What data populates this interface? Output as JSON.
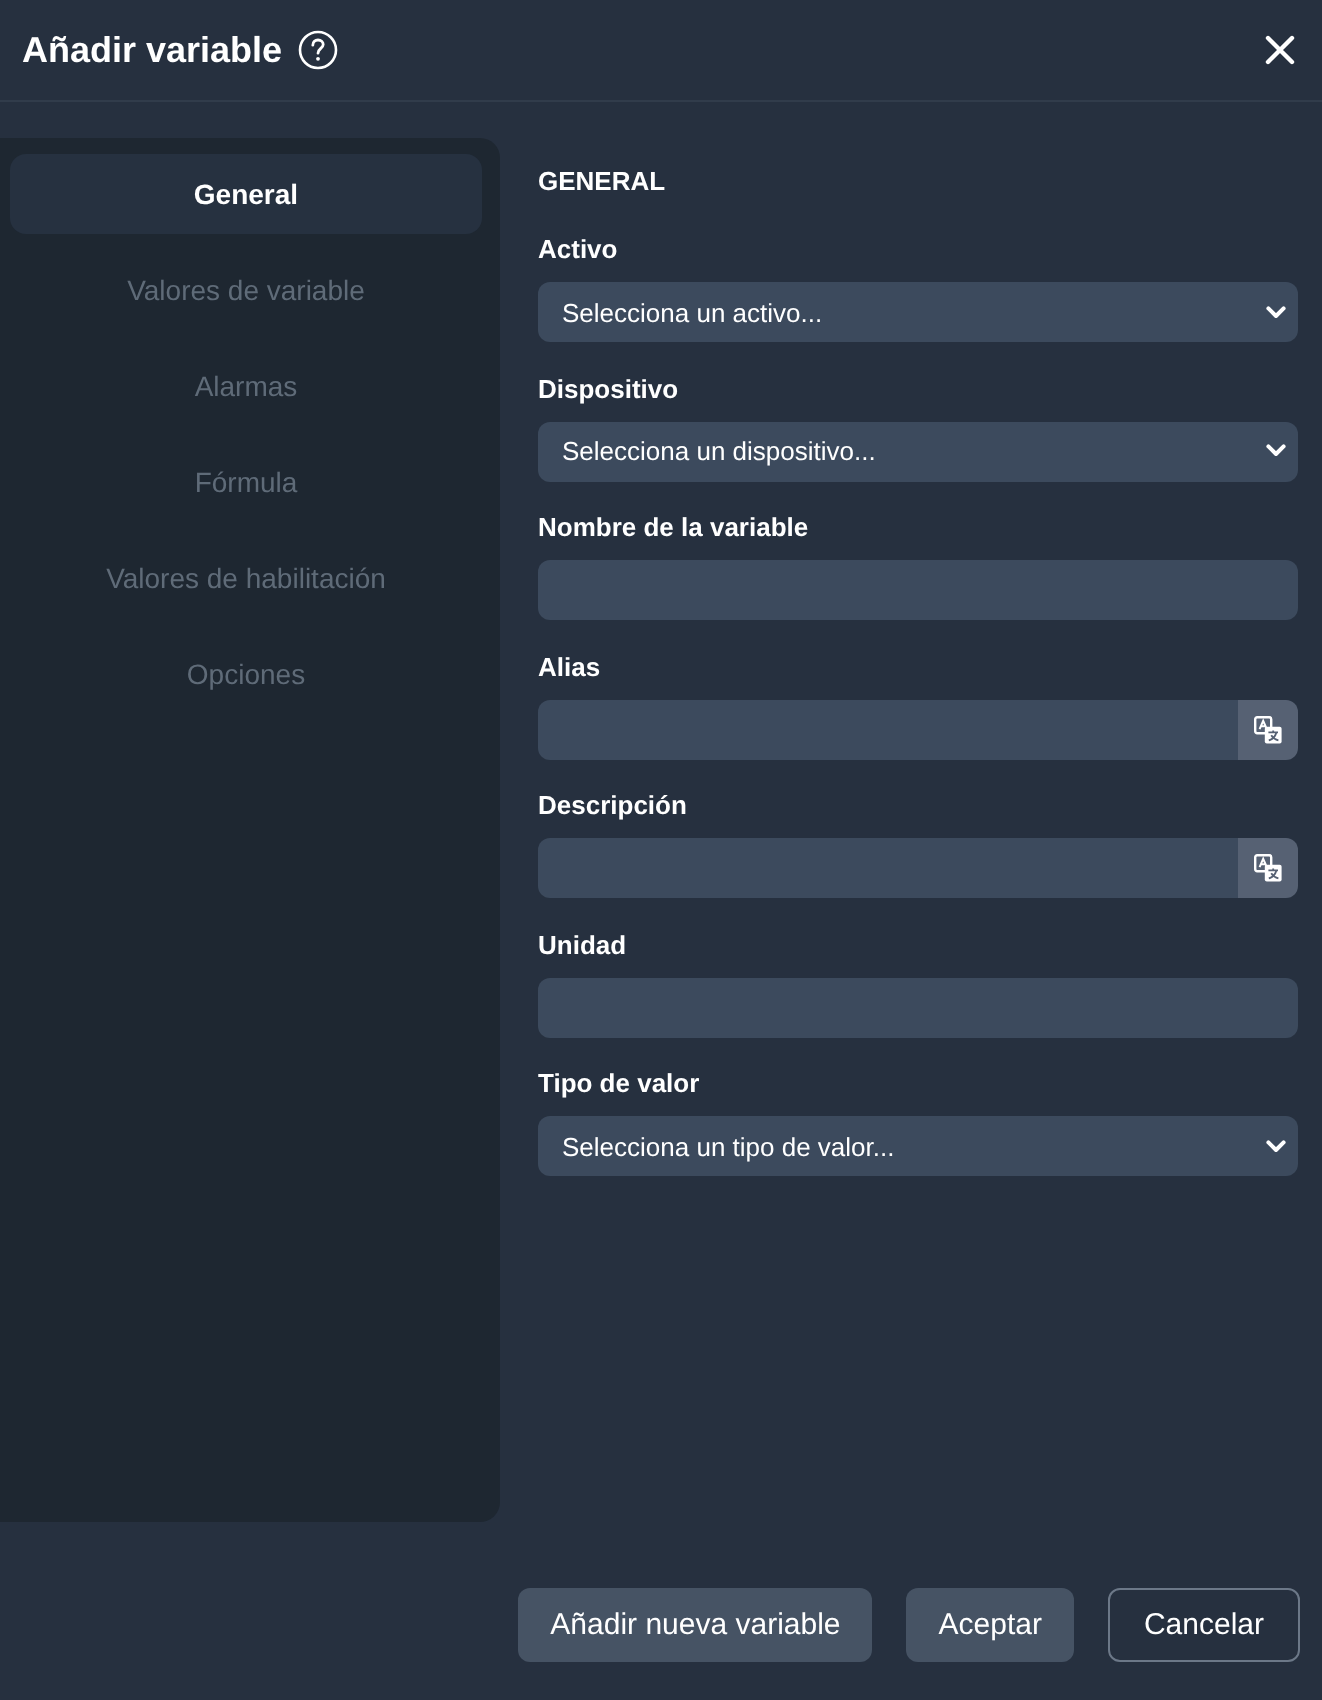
{
  "window": {
    "title": "Añadir variable"
  },
  "sidebar": {
    "items": [
      {
        "label": "General",
        "selected": true
      },
      {
        "label": "Valores de variable",
        "selected": false
      },
      {
        "label": "Alarmas",
        "selected": false
      },
      {
        "label": "Fórmula",
        "selected": false
      },
      {
        "label": "Valores de habilitación",
        "selected": false
      },
      {
        "label": "Opciones",
        "selected": false
      }
    ]
  },
  "form": {
    "section_title": "GENERAL",
    "fields": [
      {
        "kind": "select",
        "label": "Activo",
        "value": "Selecciona un activo..."
      },
      {
        "kind": "select",
        "label": "Dispositivo",
        "value": "Selecciona un dispositivo..."
      },
      {
        "kind": "text",
        "label": "Nombre de la variable"
      },
      {
        "kind": "translatable",
        "label": "Alias"
      },
      {
        "kind": "translatable",
        "label": "Descripción"
      },
      {
        "kind": "text",
        "label": "Unidad"
      },
      {
        "kind": "select",
        "label": "Tipo de valor",
        "value": "Selecciona un tipo de valor..."
      }
    ]
  },
  "buttons": [
    {
      "label": "Añadir nueva variable",
      "kind": "filled"
    },
    {
      "label": "Aceptar",
      "kind": "filled"
    },
    {
      "label": "Cancelar",
      "kind": "outline"
    }
  ]
}
